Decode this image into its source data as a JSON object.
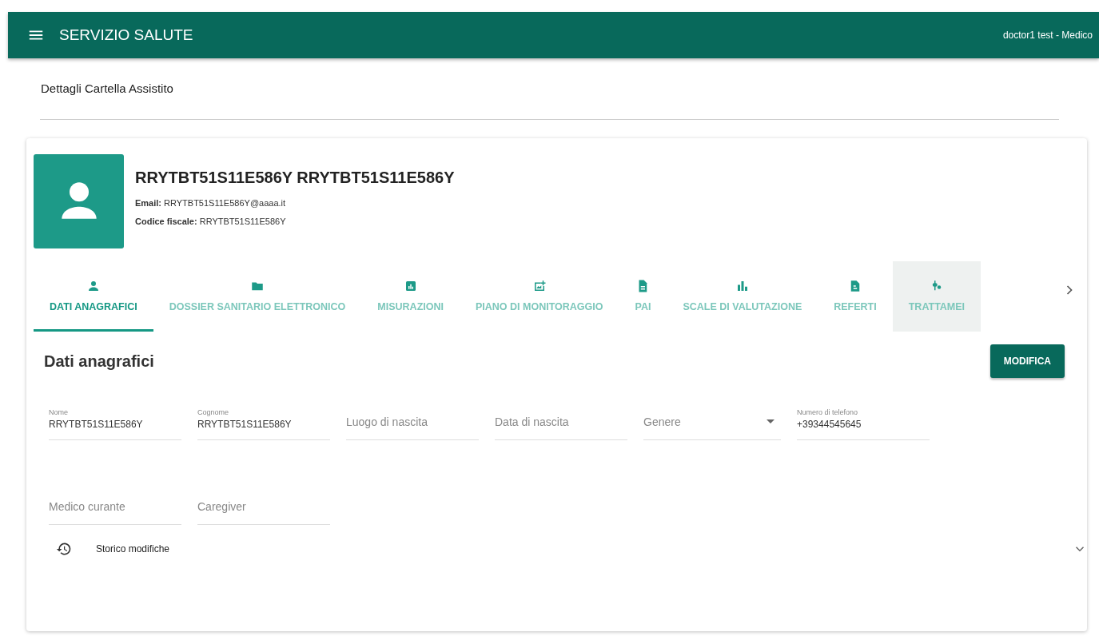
{
  "app_bar": {
    "title": "SERVIZIO SALUTE",
    "user": "doctor1 test - Medico"
  },
  "page_title": "Dettagli Cartella Assistito",
  "patient": {
    "name": "RRYTBT51S11E586Y RRYTBT51S11E586Y",
    "email_label": "Email:",
    "email": "RRYTBT51S11E586Y@aaaa.it",
    "cf_label": "Codice fiscale:",
    "cf": "RRYTBT51S11E586Y"
  },
  "tabs": [
    {
      "label": "DATI ANAGRAFICI",
      "selected": true,
      "hovered": false
    },
    {
      "label": "DOSSIER SANITARIO ELETTRONICO",
      "selected": false,
      "hovered": false
    },
    {
      "label": "MISURAZIONI",
      "selected": false,
      "hovered": false
    },
    {
      "label": "PIANO DI MONITORAGGIO",
      "selected": false,
      "hovered": false
    },
    {
      "label": "PAI",
      "selected": false,
      "hovered": false
    },
    {
      "label": "SCALE DI VALUTAZIONE",
      "selected": false,
      "hovered": false
    },
    {
      "label": "REFERTI",
      "selected": false,
      "hovered": false
    },
    {
      "label": "TRATTAMEI",
      "selected": false,
      "hovered": true
    }
  ],
  "section": {
    "title": "Dati anagrafici",
    "button": "MODIFICA"
  },
  "field_rows": [
    [
      {
        "kind": "text",
        "label": "Nome",
        "value": "RRYTBT51S11E586Y"
      },
      {
        "kind": "text",
        "label": "Cognome",
        "value": "RRYTBT51S11E586Y"
      },
      {
        "kind": "text",
        "placeholder": "Luogo di nascita"
      },
      {
        "kind": "text",
        "placeholder": "Data di nascita"
      },
      {
        "kind": "select",
        "placeholder": "Genere"
      },
      {
        "kind": "text",
        "label": "Numero di telefono",
        "value": "+39344545645"
      }
    ],
    [
      {
        "kind": "text",
        "placeholder": "Medico curante"
      },
      {
        "kind": "text",
        "placeholder": "Caregiver"
      }
    ]
  ],
  "history": {
    "label": "Storico modifiche",
    "expanded": false
  }
}
